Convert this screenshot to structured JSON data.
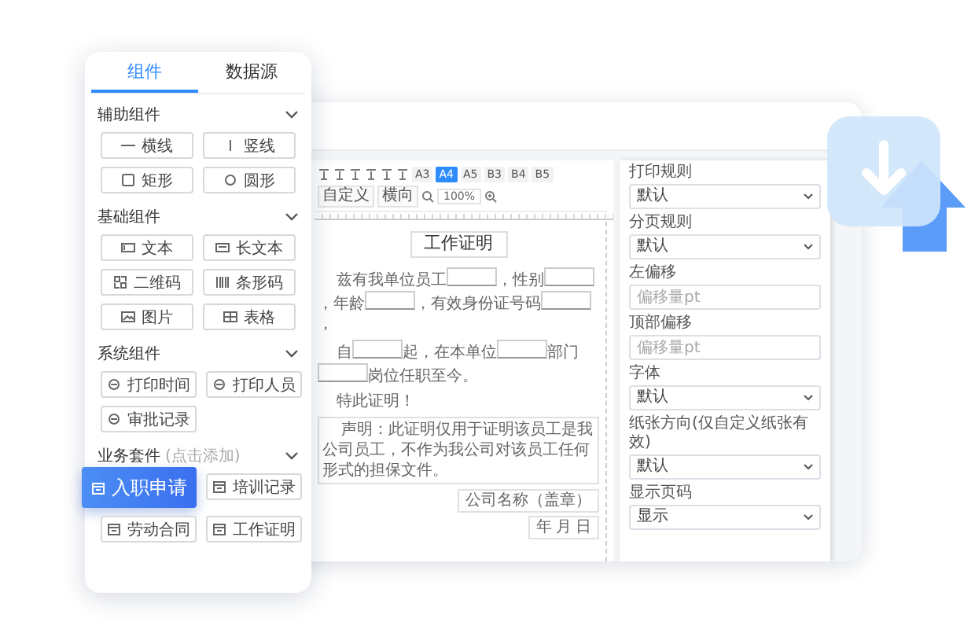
{
  "panel": {
    "tabs": [
      {
        "label": "组件",
        "selected": true
      },
      {
        "label": "数据源",
        "selected": false
      }
    ],
    "sections": [
      {
        "title": "辅助组件",
        "expanded": true,
        "items": [
          {
            "label": "横线",
            "dragging": false
          },
          {
            "label": "竖线",
            "dragging": false
          },
          {
            "label": "矩形",
            "dragging": false
          },
          {
            "label": "圆形",
            "dragging": false
          }
        ]
      },
      {
        "title": "基础组件",
        "expanded": true,
        "items": [
          {
            "label": "文本",
            "dragging": false
          },
          {
            "label": "长文本",
            "dragging": false
          },
          {
            "label": "二维码",
            "dragging": false
          },
          {
            "label": "条形码",
            "dragging": false
          },
          {
            "label": "图片",
            "dragging": false
          },
          {
            "label": "表格",
            "dragging": false
          }
        ]
      },
      {
        "title": "系统组件",
        "expanded": true,
        "items": [
          {
            "label": "打印时间",
            "dragging": false
          },
          {
            "label": "打印人员",
            "dragging": false
          },
          {
            "label": "审批记录",
            "dragging": false
          }
        ]
      },
      {
        "title": "业务套件",
        "hint": "(点击添加)",
        "expanded": true,
        "items": [
          {
            "label": "入职申请",
            "dragging": true
          },
          {
            "label": "培训记录",
            "dragging": false
          },
          {
            "label": "劳动合同",
            "dragging": false
          },
          {
            "label": "工作证明",
            "dragging": false
          }
        ]
      }
    ]
  },
  "toolbar": {
    "paper_sizes": [
      {
        "label": "A3",
        "selected": false
      },
      {
        "label": "A4",
        "selected": true
      },
      {
        "label": "A5",
        "selected": false
      },
      {
        "label": "B3",
        "selected": false
      },
      {
        "label": "B4",
        "selected": false
      },
      {
        "label": "B5",
        "selected": false
      }
    ],
    "buttons": [
      "自定义",
      "横向"
    ],
    "zoom": "100%"
  },
  "document": {
    "title": "工作证明",
    "paragraphs": [
      {
        "segments": [
          {
            "kind": "text",
            "text": "兹有我单位员工"
          },
          {
            "kind": "blank"
          },
          {
            "kind": "text",
            "text": "，性别"
          },
          {
            "kind": "blank"
          },
          {
            "kind": "text",
            "text": "，年龄"
          },
          {
            "kind": "blank"
          },
          {
            "kind": "text",
            "text": "，有效身份证号码"
          },
          {
            "kind": "blank"
          },
          {
            "kind": "text",
            "text": "，"
          }
        ]
      },
      {
        "segments": [
          {
            "kind": "text",
            "text": "自"
          },
          {
            "kind": "blank"
          },
          {
            "kind": "text",
            "text": "起，在本单位"
          },
          {
            "kind": "blank"
          },
          {
            "kind": "text",
            "text": "部门"
          },
          {
            "kind": "blank"
          },
          {
            "kind": "text",
            "text": "岗位任职至今。"
          }
        ]
      },
      {
        "segments": [
          {
            "kind": "text",
            "text": "特此证明！"
          }
        ]
      }
    ],
    "statement": "声明：此证明仅用于证明该员工是我公司员工，不作为我公司对该员工任何形式的担保文件。",
    "signature": [
      "公司名称（盖章）",
      "年 月 日"
    ]
  },
  "properties": [
    {
      "label": "打印规则",
      "kind": "select",
      "value": "默认"
    },
    {
      "label": "分页规则",
      "kind": "select",
      "value": "默认"
    },
    {
      "label": "左偏移",
      "kind": "input",
      "placeholder": "偏移量pt"
    },
    {
      "label": "顶部偏移",
      "kind": "input",
      "placeholder": "偏移量pt"
    },
    {
      "label": "字体",
      "kind": "select",
      "value": "默认"
    },
    {
      "label": "纸张方向(仅自定义纸张有效)",
      "kind": "select",
      "value": "默认"
    },
    {
      "label": "显示页码",
      "kind": "select",
      "value": "显示"
    }
  ]
}
